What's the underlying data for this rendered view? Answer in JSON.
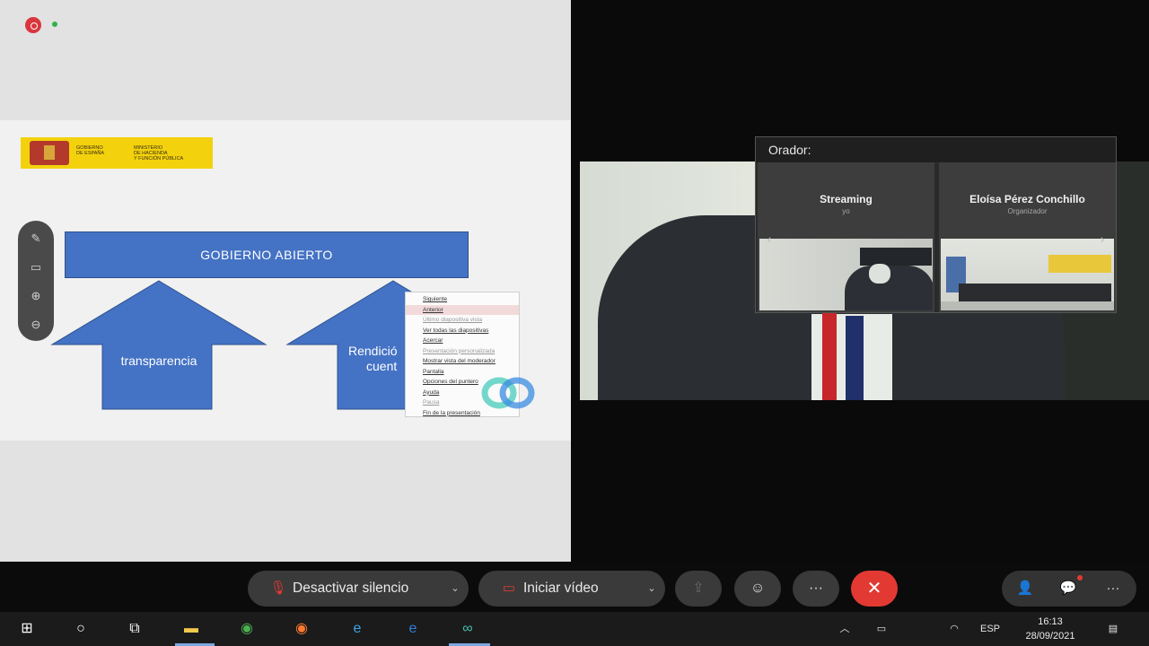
{
  "slide": {
    "logo_text_1": "GOBIERNO\nDE ESPAÑA",
    "logo_text_2": "MINISTERIO\nDE HACIENDA\nY FUNCIÓN PÚBLICA",
    "banner": "GOBIERNO ABIERTO",
    "arrow_left": "transparencia",
    "arrow_right_line1": "Rendició",
    "arrow_right_line2": "cuent"
  },
  "context_menu": [
    {
      "label": "Siguiente",
      "state": "normal"
    },
    {
      "label": "Anterior",
      "state": "highlighted"
    },
    {
      "label": "Último diapositiva vista",
      "state": "dim"
    },
    {
      "label": "Ver todas las diapositivas",
      "state": "normal"
    },
    {
      "label": "Acercar",
      "state": "normal"
    },
    {
      "label": "Presentación personalizada",
      "state": "dim"
    },
    {
      "label": "Mostrar vista del moderador",
      "state": "normal"
    },
    {
      "label": "Pantalla",
      "state": "normal"
    },
    {
      "label": "Opciones del puntero",
      "state": "normal"
    },
    {
      "label": "Ayuda",
      "state": "normal"
    },
    {
      "label": "Pausa",
      "state": "dim"
    },
    {
      "label": "Fin de la presentación",
      "state": "normal"
    }
  ],
  "speaker_panel": {
    "title": "Orador:",
    "tiles": [
      {
        "name": "Streaming",
        "role": "yo"
      },
      {
        "name": "Eloísa Pérez Conchillo",
        "role": "Organizador"
      }
    ]
  },
  "controls": {
    "unmute_label": "Desactivar silencio",
    "video_label": "Iniciar vídeo"
  },
  "taskbar": {
    "language": "ESP",
    "time": "16:13",
    "date": "28/09/2021"
  },
  "colors": {
    "slide_blue": "#4472c4",
    "end_call": "#e23a33",
    "logo_yellow": "#f3d20d"
  }
}
